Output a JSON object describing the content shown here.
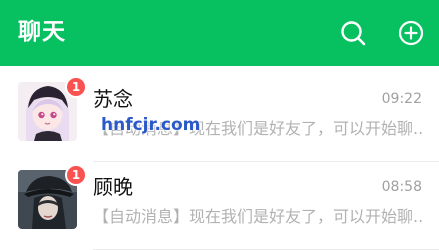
{
  "header": {
    "title": "聊天",
    "search_icon": "search-icon",
    "add_icon": "plus-circle-icon"
  },
  "chats": [
    {
      "name": "苏念",
      "time": "09:22",
      "message": "【自动消息】现在我们是好友了，可以开始聊...",
      "unread": "1"
    },
    {
      "name": "顾晚",
      "time": "08:58",
      "message": "【自动消息】现在我们是好友了，可以开始聊...",
      "unread": "1"
    }
  ],
  "watermark": "hnfcjr.com",
  "colors": {
    "header_bg": "#07c160",
    "badge": "#fa5151",
    "watermark": "#2b59c9"
  }
}
